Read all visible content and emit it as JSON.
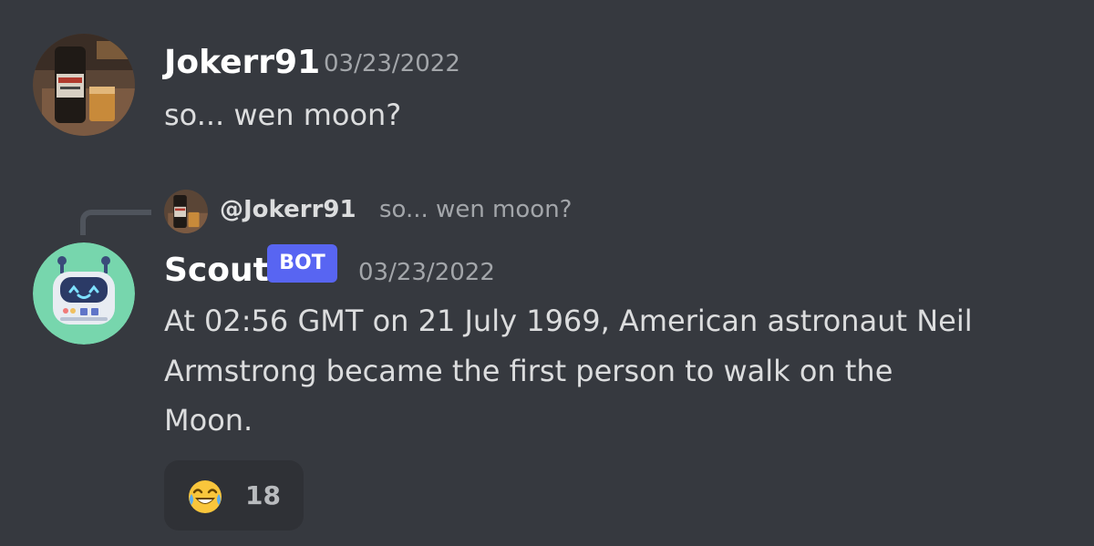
{
  "message1": {
    "username": "Jokerr91",
    "timestamp": "03/23/2022",
    "text": "so... wen moon?",
    "avatar": "user-photo-avatar"
  },
  "reply_preview": {
    "mention": "@Jokerr91",
    "text": "so... wen moon?"
  },
  "message2": {
    "username": "Scout",
    "badge": "BOT",
    "timestamp": "03/23/2022",
    "lines": [
      "At 02:56 GMT on 21 July 1969, American astronaut Neil",
      "Armstrong became the first person to walk on the",
      "Moon."
    ],
    "avatar": "robot-avatar"
  },
  "reaction": {
    "emoji": "joy-laughing-emoji",
    "count": "18"
  },
  "colors": {
    "background": "#36393f",
    "bot_badge": "#5865f2",
    "robot_avatar_bg": "#77d6ad",
    "reaction_bg": "#2f3136"
  }
}
